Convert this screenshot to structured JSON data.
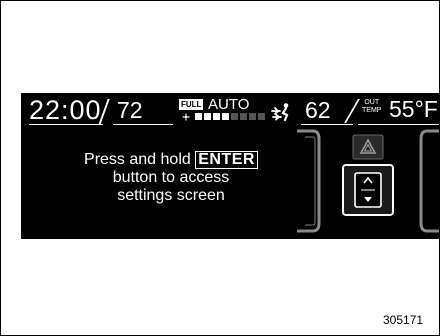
{
  "status_bar": {
    "clock": "22:00",
    "temp_left": "72",
    "full_badge": "FULL",
    "mode": "AUTO",
    "fan_level": 0.5,
    "fan_segments_total": 8,
    "fan_segments_on": 4,
    "temp_right": "62",
    "out_label_line1": "OUT",
    "out_label_line2": "TEMP",
    "outside_temp": "55°F"
  },
  "message": {
    "line1_prefix": "Press and hold",
    "key": "ENTER",
    "line2": "button to access",
    "line3": "settings screen"
  },
  "icons": {
    "fan": "fan-icon",
    "airflow": "airflow-icon",
    "hazard": "hazard-icon",
    "updown": "up-down-arrow-icon"
  },
  "footer": {
    "image_id": "305171"
  },
  "colors": {
    "display_bg": "#000000",
    "display_text": "#ffffff",
    "fan_on": "#ffffff",
    "fan_off": "#555555",
    "panel_gray": "#8a8a8a"
  }
}
